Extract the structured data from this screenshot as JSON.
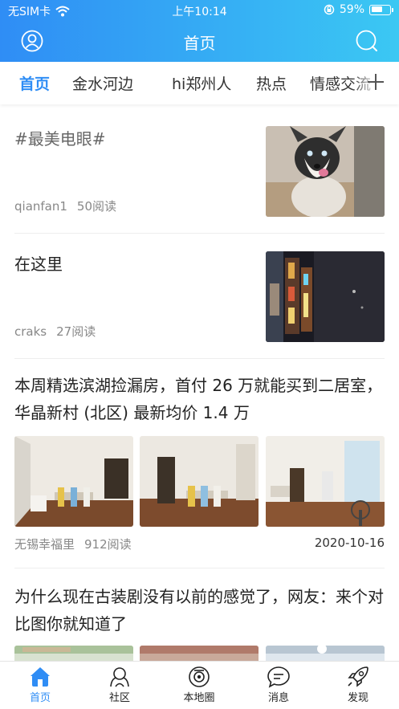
{
  "status_bar": {
    "carrier": "无SIM卡",
    "time": "上午10:14",
    "battery": "59%"
  },
  "header": {
    "title": "首页"
  },
  "tabs": [
    {
      "label": "首页",
      "active": true
    },
    {
      "label": "金水河边"
    },
    {
      "label": "hi郑州人"
    },
    {
      "label": "热点"
    },
    {
      "label": "情感交流"
    }
  ],
  "feed": [
    {
      "title": "#最美电眼#",
      "author": "qianfan1",
      "reads": "50阅读",
      "thumbnail": "husky-dog"
    },
    {
      "title": "在这里",
      "author": "craks",
      "reads": "27阅读",
      "thumbnail": "night-street"
    },
    {
      "title": "本周精选滨湖捡漏房，首付 26 万就能买到二居室，华晶新村 (北区) 最新均价 1.4 万",
      "author": "无锡幸福里",
      "reads": "912阅读",
      "date": "2020-10-16",
      "thumbnails": [
        "dining-room",
        "dining-room",
        "living-room"
      ]
    },
    {
      "title": "为什么现在古装剧没有以前的感觉了，网友：来个对比图你就知道了",
      "thumbnails": [
        "outdoor-set",
        "outdoor-set",
        "costume-drama"
      ]
    }
  ],
  "bottom_tabs": [
    {
      "label": "首页",
      "icon": "home-icon",
      "active": true
    },
    {
      "label": "社区",
      "icon": "community-icon"
    },
    {
      "label": "本地圈",
      "icon": "local-circle-icon"
    },
    {
      "label": "消息",
      "icon": "message-icon"
    },
    {
      "label": "发现",
      "icon": "discover-rocket-icon"
    }
  ],
  "colors": {
    "accent": "#2f8df5",
    "header_gradient_end": "#3bc8f3"
  }
}
